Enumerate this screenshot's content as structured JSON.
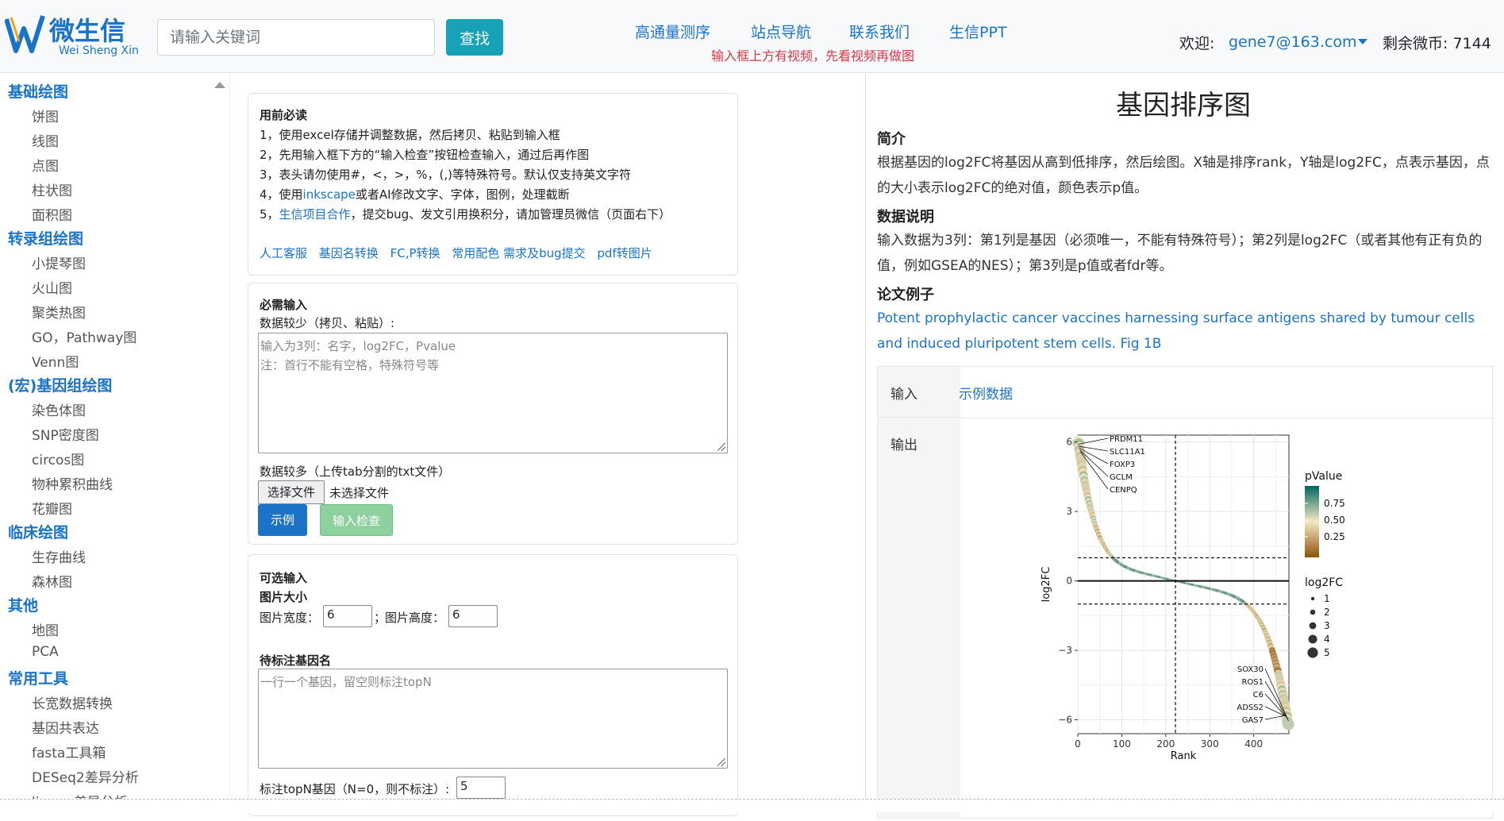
{
  "header": {
    "logo_cn": "微生信",
    "logo_en": "Wei Sheng Xin",
    "search_placeholder": "请输入关键词",
    "search_button": "查找",
    "nav": [
      "高通量测序",
      "站点导航",
      "联系我们",
      "生信PPT"
    ],
    "nav_note": "输入框上方有视频，先看视频再做图",
    "welcome": "欢迎:",
    "user_email": "gene7@163.com",
    "coins": "剩余微币: 7144"
  },
  "sidebar": {
    "sections": [
      {
        "title": "基础绘图",
        "items": [
          "饼图",
          "线图",
          "点图",
          "柱状图",
          "面积图"
        ]
      },
      {
        "title": "转录组绘图",
        "items": [
          "小提琴图",
          "火山图",
          "聚类热图",
          "GO，Pathway图",
          "Venn图"
        ]
      },
      {
        "title": "(宏)基因组绘图",
        "items": [
          "染色体图",
          "SNP密度图",
          "circos图",
          "物种累积曲线",
          "花瓣图"
        ]
      },
      {
        "title": "临床绘图",
        "items": [
          "生存曲线",
          "森林图"
        ]
      },
      {
        "title": "其他",
        "items": [
          "地图",
          "PCA"
        ]
      },
      {
        "title": "常用工具",
        "items": [
          "长宽数据转换",
          "基因共表达",
          "fasta工具箱",
          "DESeq2差异分析",
          "limma差异分析"
        ]
      }
    ]
  },
  "form": {
    "readme_title": "用前必读",
    "readme_lines": [
      "1，使用excel存储并调整数据，然后拷贝、粘贴到输入框",
      "2，先用输入框下方的“输入检查”按钮检查输入，通过后再作图",
      "3，表头请勿使用#，<，>，%，(,)等特殊符号。默认仅支持英文字符"
    ],
    "readme_4_pre": "4，使用",
    "readme_4_link": "inkscape",
    "readme_4_post": "或者AI修改文字、字体，图例，处理截断",
    "readme_5_pre": "5，",
    "readme_5_link": "生信项目合作",
    "readme_5_post": "，提交bug、发文引用换积分，请加管理员微信（页面右下）",
    "links": [
      "人工客服",
      "基因名转换",
      "FC,P转换",
      "常用配色 需求及bug提交",
      "pdf转图片"
    ],
    "required_title": "必需输入",
    "small_data_label": "数据较少（拷贝、粘贴）:",
    "textarea_ph_1": "输入为3列：名字，log2FC，Pvalue",
    "textarea_ph_2": "注：首行不能有空格，特殊符号等",
    "large_data_label": "数据较多（上传tab分割的txt文件）",
    "file_button": "选择文件",
    "file_status": "未选择文件",
    "example_button": "示例",
    "check_button": "输入检查",
    "optional_title": "可选输入",
    "size_title": "图片大小",
    "width_label": "图片宽度：",
    "width_value": "6",
    "height_sep": "；",
    "height_label": "图片高度：",
    "height_value": "6",
    "genes_title": "待标注基因名",
    "genes_placeholder": "一行一个基因，留空则标注topN",
    "topn_label": "标注topN基因（N=0，则不标注）:",
    "topn_value": "5"
  },
  "right": {
    "title": "基因排序图",
    "intro_head": "简介",
    "intro_text": "根据基因的log2FC将基因从高到低排序，然后绘图。X轴是排序rank，Y轴是log2FC，点表示基因，点的大小表示log2FC的绝对值，颜色表示p值。",
    "data_head": "数据说明",
    "data_text": "输入数据为3列：第1列是基因（必须唯一，不能有特殊符号）；第2列是log2FC（或者其他有正有负的值，例如GSEA的NES）；第3列是p值或者fdr等。",
    "paper_head": "论文例子",
    "paper_link": "Potent prophylactic cancer vaccines harnessing surface antigens shared by tumour cells and induced pluripotent stem cells. Fig 1B",
    "input_label": "输入",
    "input_link": "示例数据",
    "output_label": "输出"
  },
  "chart_data": {
    "type": "scatter",
    "xlabel": "Rank",
    "ylabel": "log2FC",
    "xlim": [
      0,
      480
    ],
    "ylim": [
      -6.6,
      6.3
    ],
    "xticks": [
      0,
      100,
      200,
      300,
      400
    ],
    "yticks": [
      6,
      3,
      0,
      -3,
      -6
    ],
    "ytick_labels": [
      "6",
      "3",
      "0",
      "−3",
      "−6"
    ],
    "hlines_dashed": [
      1,
      -1
    ],
    "hline_solid": 0,
    "vline_dashed": 222,
    "top_labels": [
      "PRDM11",
      "SLC11A1",
      "FOXP3",
      "GCLM",
      "CENPQ"
    ],
    "bottom_labels": [
      "SOX30",
      "ROS1",
      "C6",
      "ADSS2",
      "GAS7"
    ],
    "legend_color_title": "pValue",
    "legend_color_ticks": [
      "0.75",
      "0.50",
      "0.25"
    ],
    "legend_size_title": "log2FC",
    "legend_size_ticks": [
      "1",
      "2",
      "3",
      "4",
      "5"
    ],
    "n_points": 480
  }
}
